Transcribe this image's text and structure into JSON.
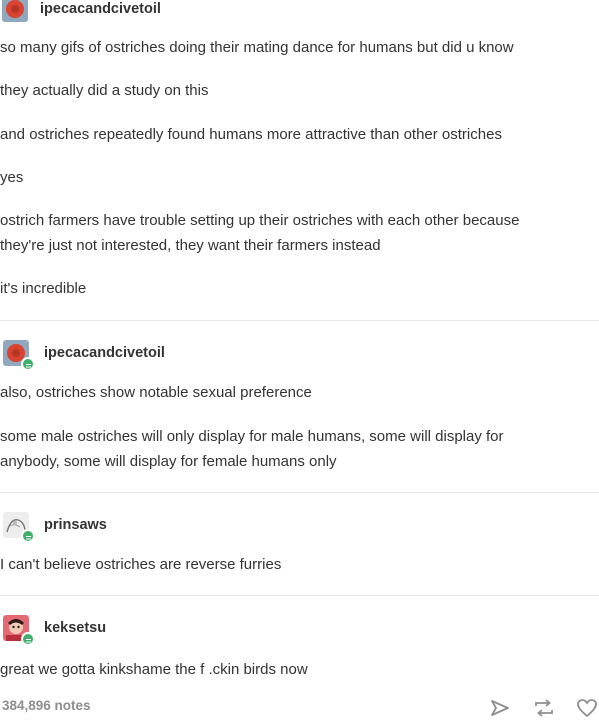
{
  "posts": [
    {
      "username": "ipecacandcivetoil",
      "avatar_icon": "red-circle-avatar-icon",
      "lines": [
        "so many gifs of ostriches doing their mating dance for humans but did u know",
        "they actually did a study on this",
        "and ostriches repeatedly found humans more attractive than other ostriches",
        "yes",
        "ostrich farmers have trouble setting up their ostriches with each other because",
        "they're just not interested, they want their farmers instead",
        "it's incredible"
      ]
    },
    {
      "username": "ipecacandcivetoil",
      "avatar_icon": "red-circle-avatar-icon",
      "lines": [
        "also, ostriches show notable sexual preference",
        "some male ostriches will only display for male humans, some will display for",
        "anybody, some will display for female humans only"
      ]
    },
    {
      "username": "prinsaws",
      "avatar_icon": "sketch-avatar-icon",
      "lines": [
        "I can't believe ostriches are reverse furries"
      ]
    },
    {
      "username": "keksetsu",
      "avatar_icon": "red-character-avatar-icon",
      "lines": [
        "great we gotta kinkshame the f .ckin birds now"
      ]
    }
  ],
  "footer": {
    "notes": "384,896 notes",
    "icons": [
      "share-icon",
      "reblog-icon",
      "like-heart-icon"
    ]
  },
  "colors": {
    "text": "#333333",
    "notes": "#8e8e8e",
    "badge": "#3fb06a",
    "divider": "#e6e6e6"
  }
}
